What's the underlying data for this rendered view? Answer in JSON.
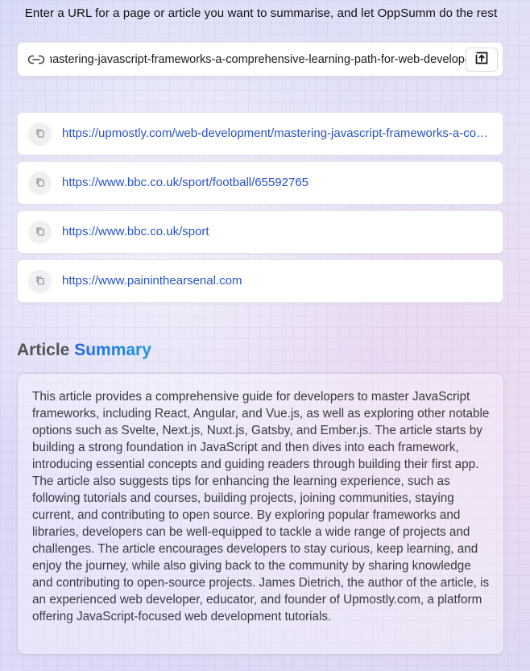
{
  "header": {
    "instruction": "Enter a URL for a page or article you want to summarise, and let OppSumm do the rest"
  },
  "url_input": {
    "value": "https://upmostly.com/web-development/mastering-javascript-frameworks-a-comprehensive-learning-path-for-web-developers",
    "icon": "link-icon",
    "submit_icon": "arrow-up-box-icon"
  },
  "history": [
    {
      "url": "https://upmostly.com/web-development/mastering-javascript-frameworks-a-comprehensive-learning-path-for-web-developers"
    },
    {
      "url": "https://www.bbc.co.uk/sport/football/65592765"
    },
    {
      "url": "https://www.bbc.co.uk/sport"
    },
    {
      "url": "https://www.paininthearsenal.com"
    }
  ],
  "summary": {
    "title_prefix": "Article",
    "title_accent": "Summary",
    "text": "This article provides a comprehensive guide for developers to master JavaScript frameworks, including React, Angular, and Vue.js, as well as exploring other notable options such as Svelte, Next.js, Nuxt.js, Gatsby, and Ember.js. The article starts by building a strong foundation in JavaScript and then dives into each framework, introducing essential concepts and guiding readers through building their first app. The article also suggests tips for enhancing the learning experience, such as following tutorials and courses, building projects, joining communities, staying current, and contributing to open source. By exploring popular frameworks and libraries, developers can be well-equipped to tackle a wide range of projects and challenges. The article encourages developers to stay curious, keep learning, and enjoy the journey, while also giving back to the community by sharing knowledge and contributing to open-source projects. James Dietrich, the author of the article, is an experienced web developer, educator, and founder of Upmostly.com, a platform offering JavaScript-focused web development tutorials."
  },
  "colors": {
    "link": "#2852c4",
    "accent_start": "#2563eb",
    "accent_end": "#1d9ad6"
  }
}
